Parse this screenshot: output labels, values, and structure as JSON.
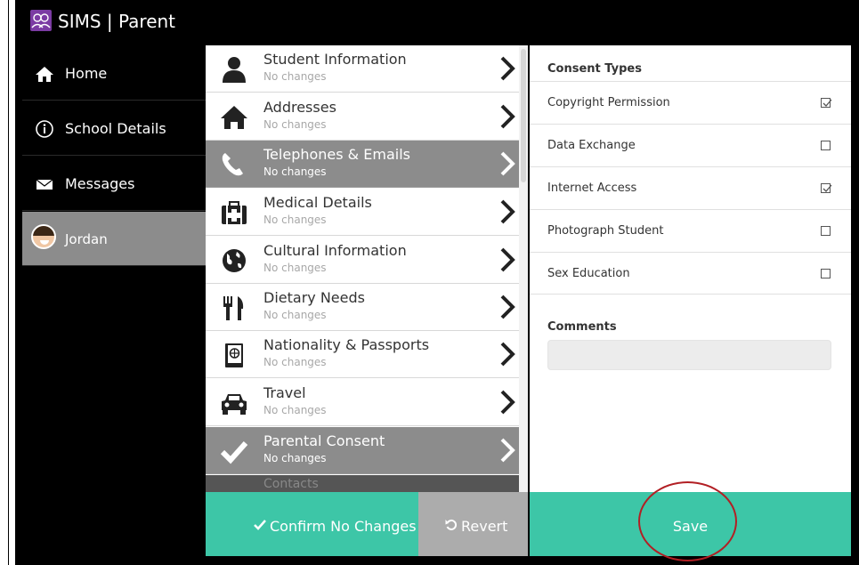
{
  "app": {
    "title": "SIMS | Parent",
    "brand_color": "#7b3ba3"
  },
  "sidebar": {
    "items": [
      {
        "label": "Home",
        "icon": "home-icon"
      },
      {
        "label": "School Details",
        "icon": "info-icon"
      },
      {
        "label": "Messages",
        "icon": "envelope-icon"
      },
      {
        "label": "Jordan",
        "icon": "avatar",
        "active": true
      }
    ]
  },
  "sections": [
    {
      "title": "Student Information",
      "status": "No changes",
      "icon": "person-icon"
    },
    {
      "title": "Addresses",
      "status": "No changes",
      "icon": "house-icon"
    },
    {
      "title": "Telephones & Emails",
      "status": "No changes",
      "icon": "phone-icon",
      "selected": true
    },
    {
      "title": "Medical Details",
      "status": "No changes",
      "icon": "medical-kit-icon"
    },
    {
      "title": "Cultural Information",
      "status": "No changes",
      "icon": "globe-icon"
    },
    {
      "title": "Dietary Needs",
      "status": "No changes",
      "icon": "cutlery-icon"
    },
    {
      "title": "Nationality & Passports",
      "status": "No changes",
      "icon": "passport-icon"
    },
    {
      "title": "Travel",
      "status": "No changes",
      "icon": "car-icon"
    },
    {
      "title": "Parental Consent",
      "status": "No changes",
      "icon": "checkmark-icon",
      "selected": true
    },
    {
      "title": "Contacts",
      "status": "",
      "icon": "",
      "partial": true
    }
  ],
  "actions": {
    "confirm": "Confirm No Changes",
    "revert": "Revert",
    "save": "Save"
  },
  "consent": {
    "header": "Consent Types",
    "types": [
      {
        "label": "Copyright Permission",
        "checked": true
      },
      {
        "label": "Data Exchange",
        "checked": false
      },
      {
        "label": "Internet Access",
        "checked": true
      },
      {
        "label": "Photograph Student",
        "checked": false
      },
      {
        "label": "Sex Education",
        "checked": false
      }
    ],
    "comments_label": "Comments",
    "comments_value": ""
  },
  "colors": {
    "accent": "#3dc6a7",
    "selected_row": "#8c8c8c",
    "annotation": "#b21f24"
  }
}
